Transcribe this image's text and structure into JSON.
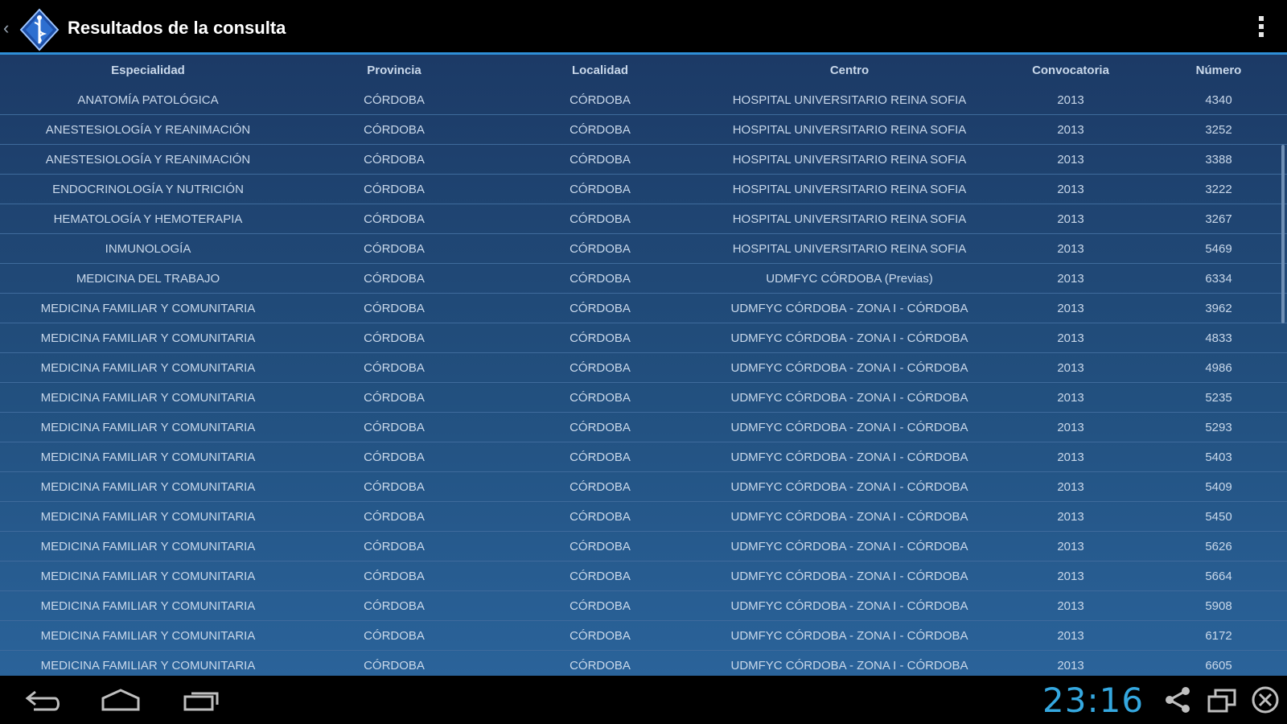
{
  "actionbar": {
    "title": "Resultados de la consulta",
    "up_caret": "‹",
    "logo_icon": "medical-caduceus-logo-icon",
    "overflow_icon": "overflow-menu-icon"
  },
  "table": {
    "headers": [
      "Especialidad",
      "Provincia",
      "Localidad",
      "Centro",
      "Convocatoria",
      "Número"
    ],
    "rows": [
      [
        "ANATOMÍA PATOLÓGICA",
        "CÓRDOBA",
        "CÓRDOBA",
        "HOSPITAL UNIVERSITARIO REINA SOFIA",
        "2013",
        "4340"
      ],
      [
        "ANESTESIOLOGÍA Y REANIMACIÓN",
        "CÓRDOBA",
        "CÓRDOBA",
        "HOSPITAL UNIVERSITARIO REINA SOFIA",
        "2013",
        "3252"
      ],
      [
        "ANESTESIOLOGÍA Y REANIMACIÓN",
        "CÓRDOBA",
        "CÓRDOBA",
        "HOSPITAL UNIVERSITARIO REINA SOFIA",
        "2013",
        "3388"
      ],
      [
        "ENDOCRINOLOGÍA Y NUTRICIÓN",
        "CÓRDOBA",
        "CÓRDOBA",
        "HOSPITAL UNIVERSITARIO REINA SOFIA",
        "2013",
        "3222"
      ],
      [
        "HEMATOLOGÍA Y HEMOTERAPIA",
        "CÓRDOBA",
        "CÓRDOBA",
        "HOSPITAL UNIVERSITARIO REINA SOFIA",
        "2013",
        "3267"
      ],
      [
        "INMUNOLOGÍA",
        "CÓRDOBA",
        "CÓRDOBA",
        "HOSPITAL UNIVERSITARIO REINA SOFIA",
        "2013",
        "5469"
      ],
      [
        "MEDICINA DEL TRABAJO",
        "CÓRDOBA",
        "CÓRDOBA",
        "UDMFYC CÓRDOBA (Previas)",
        "2013",
        "6334"
      ],
      [
        "MEDICINA FAMILIAR Y COMUNITARIA",
        "CÓRDOBA",
        "CÓRDOBA",
        "UDMFYC CÓRDOBA - ZONA I - CÓRDOBA",
        "2013",
        "3962"
      ],
      [
        "MEDICINA FAMILIAR Y COMUNITARIA",
        "CÓRDOBA",
        "CÓRDOBA",
        "UDMFYC CÓRDOBA - ZONA I - CÓRDOBA",
        "2013",
        "4833"
      ],
      [
        "MEDICINA FAMILIAR Y COMUNITARIA",
        "CÓRDOBA",
        "CÓRDOBA",
        "UDMFYC CÓRDOBA - ZONA I - CÓRDOBA",
        "2013",
        "4986"
      ],
      [
        "MEDICINA FAMILIAR Y COMUNITARIA",
        "CÓRDOBA",
        "CÓRDOBA",
        "UDMFYC CÓRDOBA - ZONA I - CÓRDOBA",
        "2013",
        "5235"
      ],
      [
        "MEDICINA FAMILIAR Y COMUNITARIA",
        "CÓRDOBA",
        "CÓRDOBA",
        "UDMFYC CÓRDOBA - ZONA I - CÓRDOBA",
        "2013",
        "5293"
      ],
      [
        "MEDICINA FAMILIAR Y COMUNITARIA",
        "CÓRDOBA",
        "CÓRDOBA",
        "UDMFYC CÓRDOBA - ZONA I - CÓRDOBA",
        "2013",
        "5403"
      ],
      [
        "MEDICINA FAMILIAR Y COMUNITARIA",
        "CÓRDOBA",
        "CÓRDOBA",
        "UDMFYC CÓRDOBA - ZONA I - CÓRDOBA",
        "2013",
        "5409"
      ],
      [
        "MEDICINA FAMILIAR Y COMUNITARIA",
        "CÓRDOBA",
        "CÓRDOBA",
        "UDMFYC CÓRDOBA - ZONA I - CÓRDOBA",
        "2013",
        "5450"
      ],
      [
        "MEDICINA FAMILIAR Y COMUNITARIA",
        "CÓRDOBA",
        "CÓRDOBA",
        "UDMFYC CÓRDOBA - ZONA I - CÓRDOBA",
        "2013",
        "5626"
      ],
      [
        "MEDICINA FAMILIAR Y COMUNITARIA",
        "CÓRDOBA",
        "CÓRDOBA",
        "UDMFYC CÓRDOBA - ZONA I - CÓRDOBA",
        "2013",
        "5664"
      ],
      [
        "MEDICINA FAMILIAR Y COMUNITARIA",
        "CÓRDOBA",
        "CÓRDOBA",
        "UDMFYC CÓRDOBA - ZONA I - CÓRDOBA",
        "2013",
        "5908"
      ],
      [
        "MEDICINA FAMILIAR Y COMUNITARIA",
        "CÓRDOBA",
        "CÓRDOBA",
        "UDMFYC CÓRDOBA - ZONA I - CÓRDOBA",
        "2013",
        "6172"
      ],
      [
        "MEDICINA FAMILIAR Y COMUNITARIA",
        "CÓRDOBA",
        "CÓRDOBA",
        "UDMFYC CÓRDOBA - ZONA I - CÓRDOBA",
        "2013",
        "6605"
      ]
    ]
  },
  "navbar": {
    "clock": "23:16",
    "icons": [
      "back-icon",
      "home-icon",
      "recent-apps-icon",
      "share-icon",
      "window-icon",
      "close-icon"
    ]
  },
  "colors": {
    "accent": "#2f8fd8",
    "clock": "#35a8e0",
    "table_text": "#c9d8ea",
    "table_bg_top": "#1c3a66",
    "table_bg_bottom": "#2a639a"
  }
}
